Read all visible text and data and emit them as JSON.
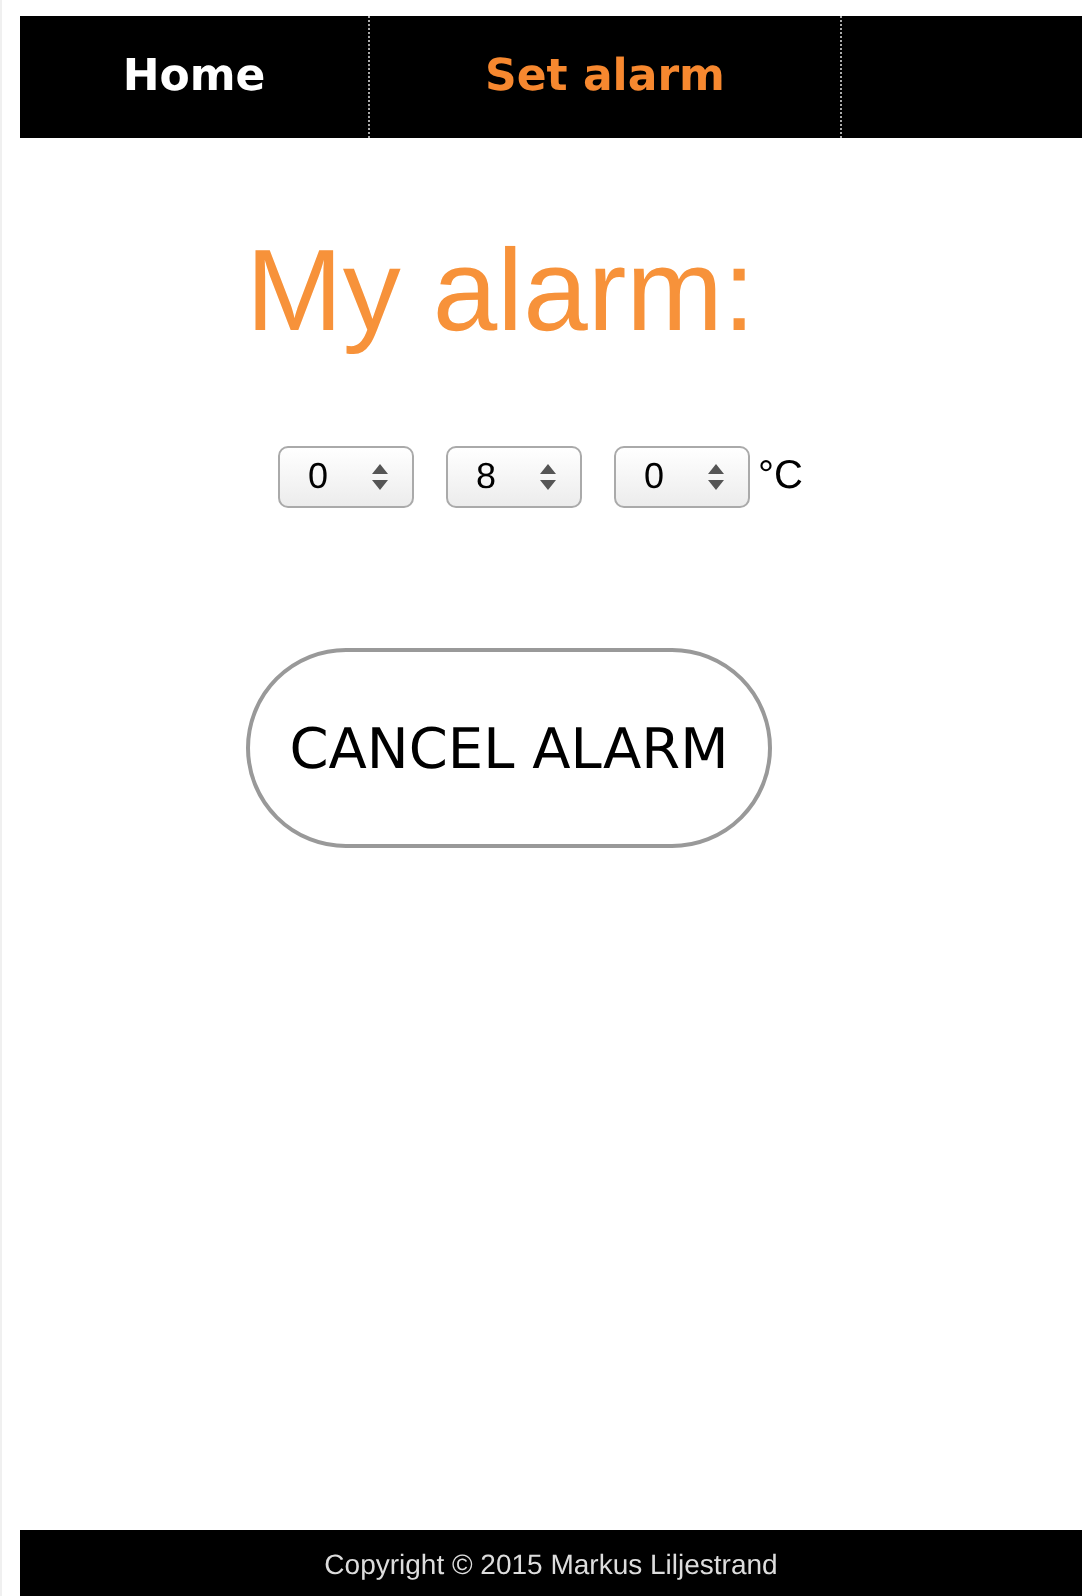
{
  "nav": {
    "tabs": [
      {
        "label": "Home",
        "selected": false
      },
      {
        "label": "Set alarm",
        "selected": true
      }
    ]
  },
  "title": "My alarm:",
  "selects": [
    {
      "value": "0"
    },
    {
      "value": "8"
    },
    {
      "value": "0"
    }
  ],
  "unit": "°C",
  "cancel_button": "CANCEL ALARM",
  "footer": "Copyright © 2015 Markus Liljestrand"
}
